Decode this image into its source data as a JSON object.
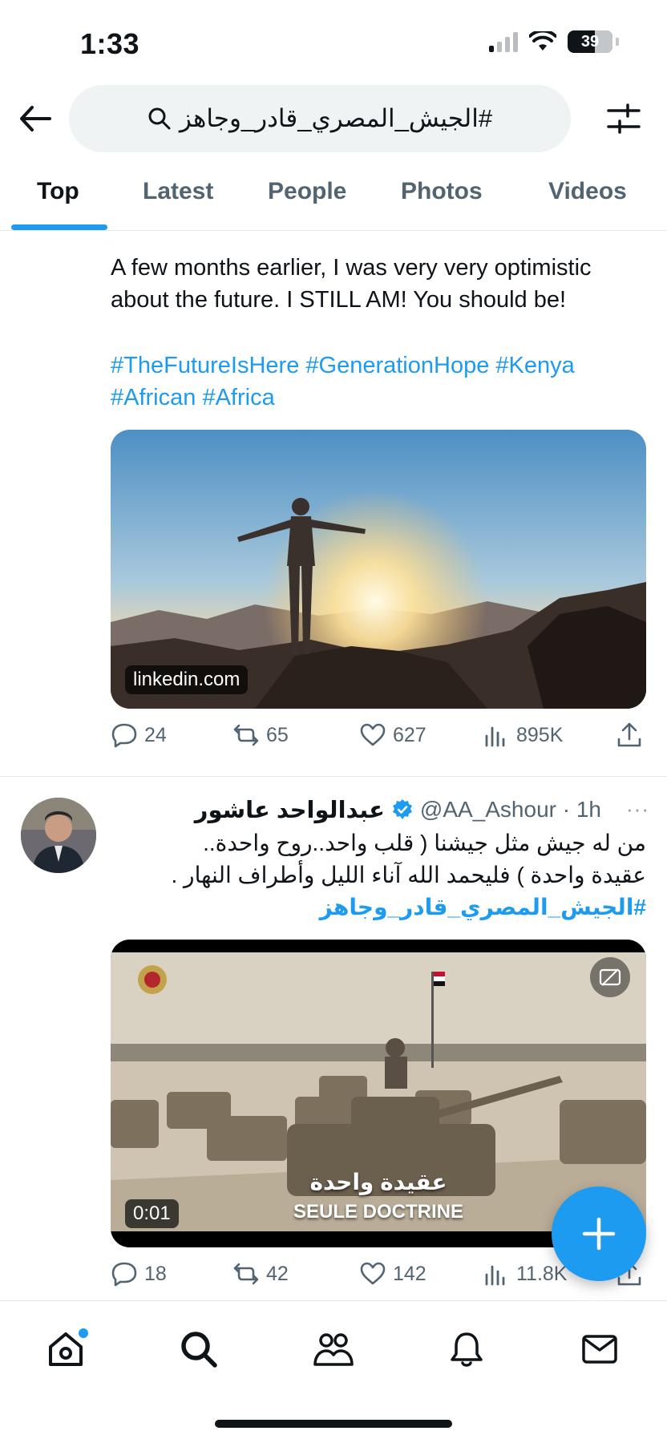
{
  "status_bar": {
    "time": "1:33",
    "battery": "39"
  },
  "search": {
    "query": "#الجيش_المصري_قادر_وجاهز"
  },
  "tabs": [
    {
      "label": "Top",
      "active": true
    },
    {
      "label": "Latest",
      "active": false
    },
    {
      "label": "People",
      "active": false
    },
    {
      "label": "Photos",
      "active": false
    },
    {
      "label": "Videos",
      "active": false
    }
  ],
  "tweet1": {
    "text_line1": "A few months earlier, I was very very optimistic",
    "text_line2": "about the future. I STILL AM! You should be!",
    "hashtags_line1": "#TheFutureIsHere #GenerationHope #Kenya",
    "hashtags_line2": "#African #Africa",
    "media_source": "linkedin.com",
    "replies": "24",
    "reposts": "65",
    "likes": "627",
    "views": "895K"
  },
  "tweet2": {
    "author_name": "عبدالواحد عاشور",
    "handle_time": "@AA_Ashour · 1h",
    "more": "···",
    "text_line1": "من له جيش مثل جيشنا ( قلب واحد..روح واحدة..",
    "text_line2": "عقيدة واحدة ) فليحمد الله آناء الليل وأطراف النهار .",
    "hashtag": "#الجيش_المصري_قادر_وجاهز",
    "video_caption_ar": "عقيدة واحدة",
    "video_caption_fr": "SEULE DOCTRINE",
    "video_time": "0:01",
    "replies": "18",
    "reposts": "42",
    "likes": "142",
    "views": "11.8K"
  },
  "colors": {
    "accent": "#1d9bf0",
    "muted": "#536471",
    "text": "#0f1419"
  }
}
